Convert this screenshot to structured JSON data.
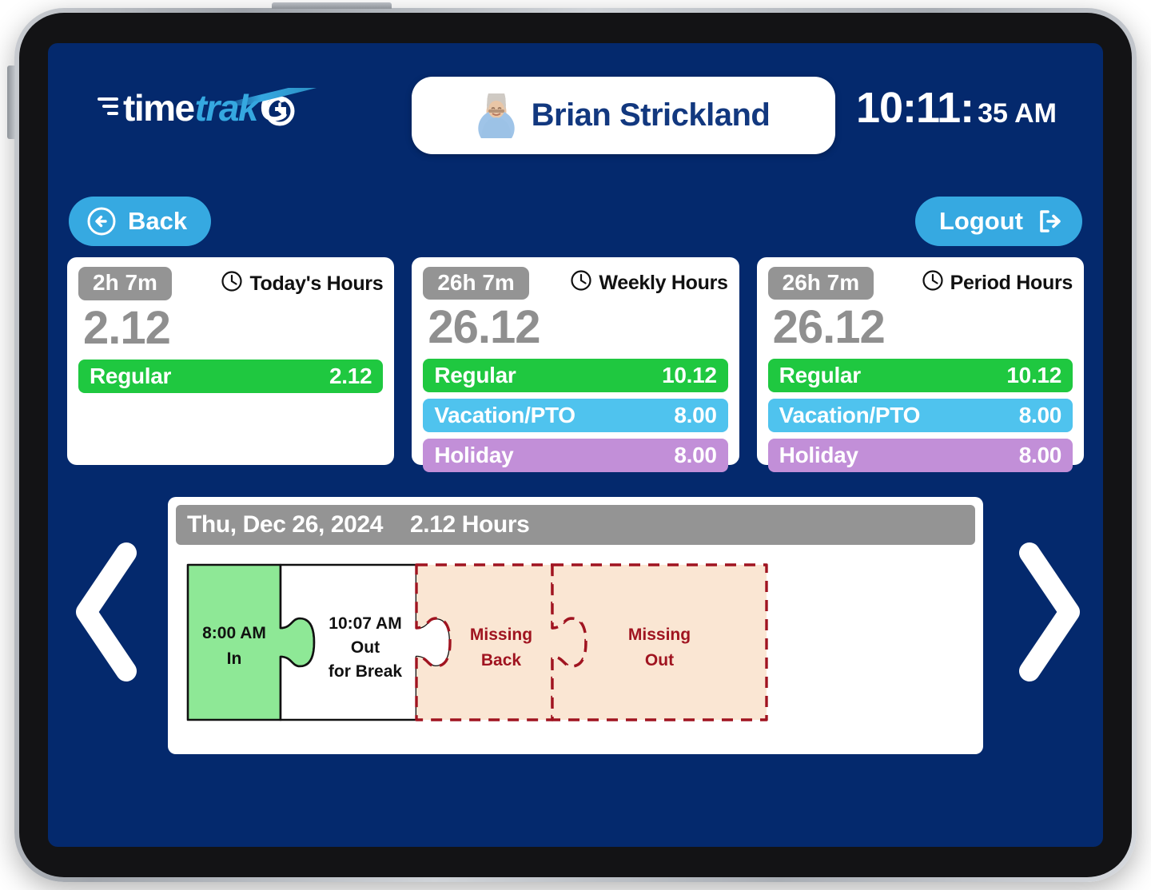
{
  "app": {
    "logo": {
      "part1": "time",
      "part2": "trak",
      "part3": "G",
      "icon": "clock-icon"
    },
    "user": {
      "name": "Brian Strickland",
      "avatar": "user-avatar"
    },
    "clock": {
      "time": "10:11:",
      "seconds_meridiem": "35 AM"
    }
  },
  "nav": {
    "back_label": "Back",
    "back_icon": "arrow-left-circle-icon",
    "logout_label": "Logout",
    "logout_icon": "logout-icon",
    "prev_icon": "chevron-left-icon",
    "next_icon": "chevron-right-icon"
  },
  "colors": {
    "screen_bg": "#04296d",
    "accent": "#36a9e1",
    "regular": "#1fc840",
    "vacation": "#4fc3ee",
    "holiday": "#c28fd8",
    "neutral": "#949494",
    "missing": "#a01420",
    "missing_fill": "#fae6d3",
    "in_fill": "#8ee896"
  },
  "cards": [
    {
      "duration": "2h 7m",
      "label": "Today's Hours",
      "icon": "clock-icon",
      "total": "2.12",
      "rows": [
        {
          "name": "Regular",
          "value": "2.12",
          "type": "regular"
        }
      ]
    },
    {
      "duration": "26h 7m",
      "label": "Weekly Hours",
      "icon": "clock-icon",
      "total": "26.12",
      "rows": [
        {
          "name": "Regular",
          "value": "10.12",
          "type": "regular"
        },
        {
          "name": "Vacation/PTO",
          "value": "8.00",
          "type": "vacation"
        },
        {
          "name": "Holiday",
          "value": "8.00",
          "type": "holiday"
        }
      ]
    },
    {
      "duration": "26h 7m",
      "label": "Period Hours",
      "icon": "clock-icon",
      "total": "26.12",
      "rows": [
        {
          "name": "Regular",
          "value": "10.12",
          "type": "regular"
        },
        {
          "name": "Vacation/PTO",
          "value": "8.00",
          "type": "vacation"
        },
        {
          "name": "Holiday",
          "value": "8.00",
          "type": "holiday"
        }
      ]
    }
  ],
  "timeline": {
    "date": "Thu, Dec 26, 2024",
    "hours": "2.12 Hours",
    "segments": [
      {
        "state": "complete",
        "fill": "in_fill",
        "line1": "8:00 AM",
        "line2": "In",
        "line3": ""
      },
      {
        "state": "complete",
        "fill": "white",
        "line1": "10:07 AM",
        "line2": "Out",
        "line3": "for Break"
      },
      {
        "state": "missing",
        "fill": "missing_fill",
        "line1": "Missing",
        "line2": "Back",
        "line3": ""
      },
      {
        "state": "missing",
        "fill": "missing_fill",
        "line1": "Missing",
        "line2": "Out",
        "line3": ""
      }
    ]
  }
}
